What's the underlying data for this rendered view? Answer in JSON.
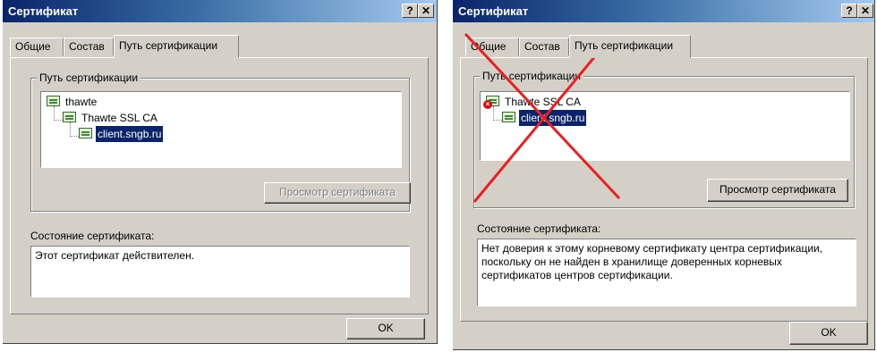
{
  "left": {
    "title": "Сертификат",
    "help_btn": "?",
    "close_btn": "✕",
    "tabs": [
      "Общие",
      "Состав",
      "Путь сертификации"
    ],
    "group_label": "Путь сертификации",
    "tree": [
      "thawte",
      "Thawte SSL CA",
      "client.sngb.ru"
    ],
    "view_cert_btn": "Просмотр сертификата",
    "status_label": "Состояние сертификата:",
    "status_text": "Этот сертификат действителен.",
    "ok_btn": "OK"
  },
  "right": {
    "title": "Сертификат",
    "help_btn": "?",
    "close_btn": "✕",
    "tabs": [
      "Общие",
      "Состав",
      "Путь сертификации"
    ],
    "group_label": "Путь сертификации",
    "tree": [
      "Thawte SSL CA",
      "client.sngb.ru"
    ],
    "view_cert_btn": "Просмотр сертификата",
    "status_label": "Состояние сертификата:",
    "status_text": "Нет доверия к этому корневому сертификату центра сертификации, поскольку он не найден в хранилище доверенных корневых сертификатов центров сертификации.",
    "ok_btn": "OK",
    "overlay_color": "#e82020"
  }
}
